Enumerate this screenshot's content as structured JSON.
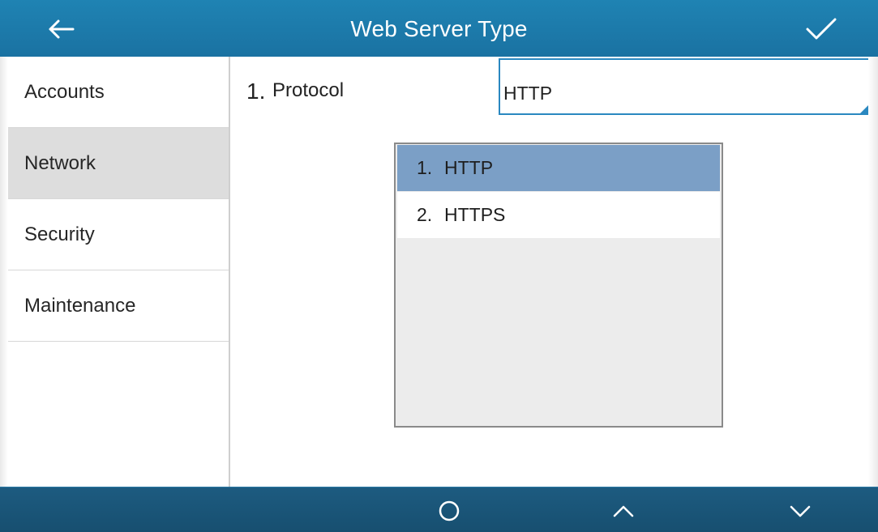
{
  "header": {
    "title": "Web Server Type",
    "back_icon": "arrow-left-icon",
    "confirm_icon": "checkmark-icon"
  },
  "sidebar": {
    "items": [
      {
        "label": "Accounts",
        "active": false
      },
      {
        "label": "Network",
        "active": true
      },
      {
        "label": "Security",
        "active": false
      },
      {
        "label": "Maintenance",
        "active": false
      }
    ]
  },
  "form": {
    "row_index": "1.",
    "row_label": "Protocol",
    "current_value": "HTTP"
  },
  "dropdown": {
    "options": [
      {
        "num": "1.",
        "label": "HTTP",
        "selected": true
      },
      {
        "num": "2.",
        "label": "HTTPS",
        "selected": false
      }
    ]
  },
  "bottombar": {
    "icons": [
      "home-circle-icon",
      "chevron-up-icon",
      "chevron-down-icon"
    ]
  },
  "colors": {
    "header_bg": "#1f83b3",
    "accent": "#2a88c0",
    "selected_option": "#7b9fc6",
    "bottom_bar": "#1d5b80"
  }
}
